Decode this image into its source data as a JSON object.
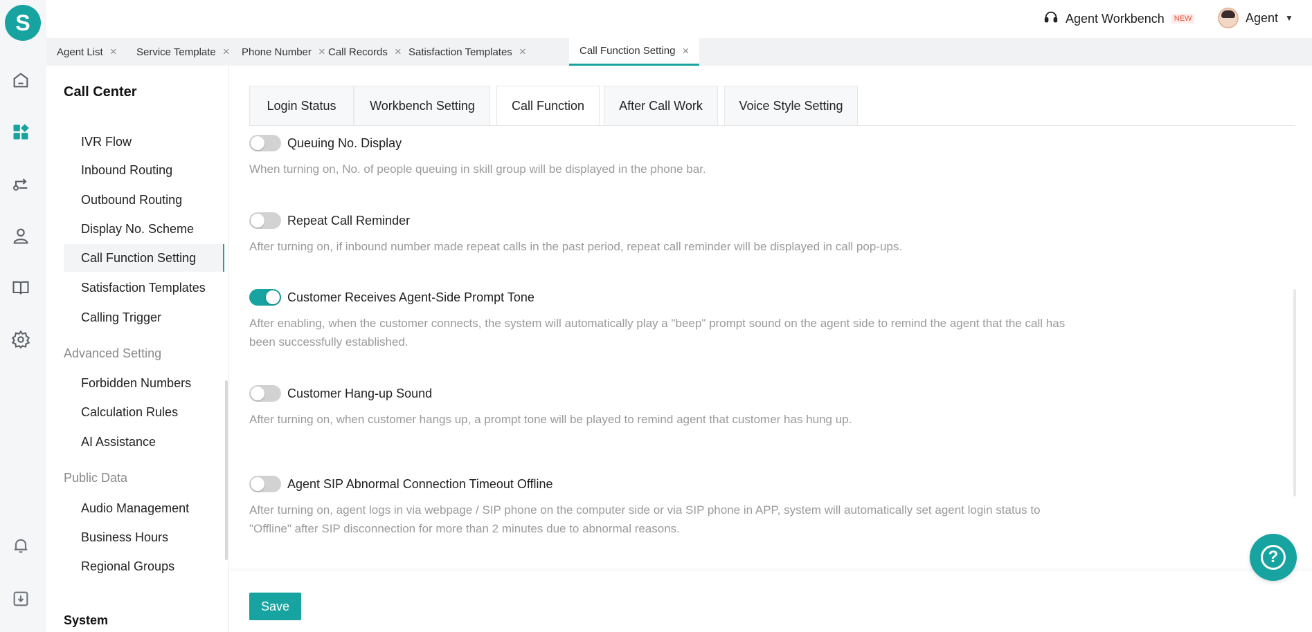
{
  "app": {
    "logo_letter": "S",
    "accent": "#17a3a0"
  },
  "rail": {
    "icons": [
      "home-icon",
      "dashboard-icon",
      "routing-icon",
      "agent-icon",
      "book-icon",
      "settings-icon",
      "bell-icon",
      "download-icon"
    ]
  },
  "header": {
    "workbench_label": "Agent Workbench",
    "new_badge": "NEW",
    "user_name": "Agent"
  },
  "tabs": [
    {
      "label": "Agent List"
    },
    {
      "label": "Service Template"
    },
    {
      "label": "Phone Number"
    },
    {
      "label": "Call Records"
    },
    {
      "label": "Satisfaction Templates"
    },
    {
      "label": "Call Function Setting",
      "active": true
    }
  ],
  "sidebar": {
    "title": "Call Center",
    "items": [
      {
        "label": "IVR Flow"
      },
      {
        "label": "Inbound Routing"
      },
      {
        "label": "Outbound Routing"
      },
      {
        "label": "Display No. Scheme"
      },
      {
        "label": "Call Function Setting",
        "active": true
      },
      {
        "label": "Satisfaction Templates"
      },
      {
        "label": "Calling Trigger"
      }
    ],
    "groups": [
      {
        "title": "Advanced Setting",
        "items": [
          "Forbidden Numbers",
          "Calculation Rules",
          "AI Assistance"
        ]
      },
      {
        "title": "Public Data",
        "items": [
          "Audio Management",
          "Business Hours",
          "Regional Groups"
        ]
      }
    ],
    "bottom_title": "System"
  },
  "function_tabs": [
    {
      "label": "Login Status"
    },
    {
      "label": "Workbench Setting"
    },
    {
      "label": "Call Function",
      "active": true
    },
    {
      "label": "After Call Work"
    },
    {
      "label": "Voice Style Setting"
    }
  ],
  "settings": [
    {
      "title": "Queuing No. Display",
      "enabled": false,
      "description": "When turning on, No. of people queuing in skill group will be displayed in the phone bar."
    },
    {
      "title": "Repeat Call Reminder",
      "enabled": false,
      "description": "After turning on, if inbound number made repeat calls in the past period, repeat call reminder will be displayed in call pop-ups."
    },
    {
      "title": "Customer Receives Agent-Side Prompt Tone",
      "enabled": true,
      "description": "After enabling, when the customer connects, the system will automatically play a \"beep\" prompt sound on the agent side to remind the agent that the call has been successfully established."
    },
    {
      "title": "Customer Hang-up Sound",
      "enabled": false,
      "description": "After turning on, when customer hangs up, a prompt tone will be played to remind agent that customer has hung up."
    },
    {
      "title": "Agent SIP Abnormal Connection Timeout Offline",
      "enabled": false,
      "description": "After turning on, agent logs in via webpage / SIP phone on the computer side or via SIP phone in APP, system will automatically set agent login status to \"Offline\" after SIP disconnection for more than 2 minutes due to abnormal reasons."
    }
  ],
  "footer": {
    "save_label": "Save"
  },
  "help": {
    "symbol": "?"
  }
}
